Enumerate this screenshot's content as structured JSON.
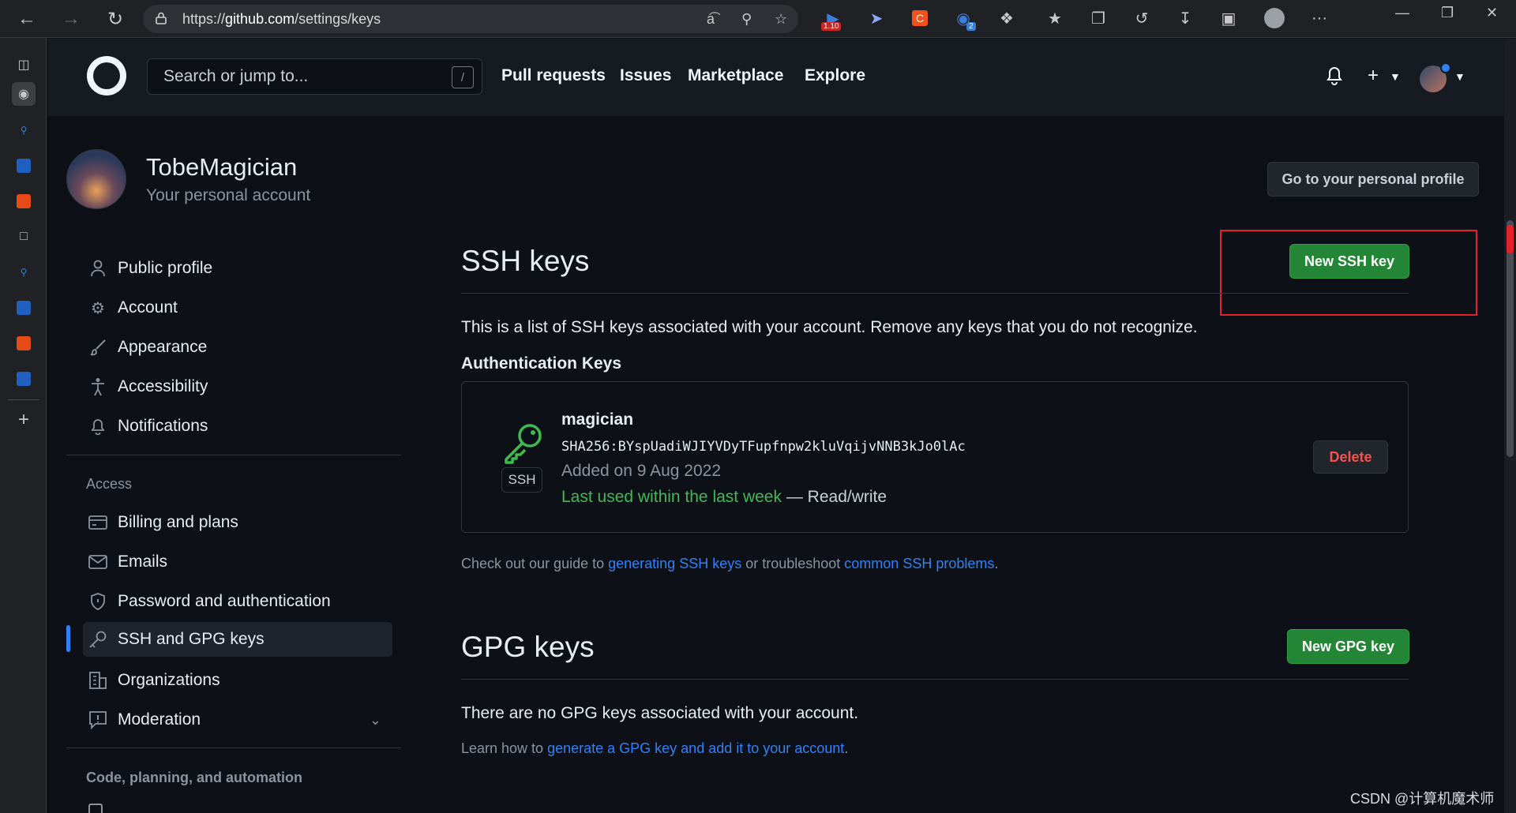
{
  "browser": {
    "url_prefix": "https://",
    "url_domain": "github.com",
    "url_path": "/settings/keys",
    "extension_badge_1": "1.10",
    "extension_badge_2": "2",
    "more": "···"
  },
  "header": {
    "search_placeholder": "Search or jump to...",
    "search_shortcut": "/",
    "nav": [
      "Pull requests",
      "Issues",
      "Marketplace",
      "Explore"
    ]
  },
  "profile": {
    "name": "TobeMagician",
    "subtitle": "Your personal account",
    "button": "Go to your personal profile"
  },
  "menu": {
    "items_top": [
      "Public profile",
      "Account",
      "Appearance",
      "Accessibility",
      "Notifications"
    ],
    "access_heading": "Access",
    "items_access": [
      "Billing and plans",
      "Emails",
      "Password and authentication",
      "SSH and GPG keys",
      "Organizations",
      "Moderation"
    ],
    "code_heading": "Code, planning, and automation"
  },
  "ssh": {
    "title": "SSH keys",
    "new_button": "New SSH key",
    "description": "This is a list of SSH keys associated with your account. Remove any keys that you do not recognize.",
    "auth_heading": "Authentication Keys",
    "key": {
      "name": "magician",
      "badge": "SSH",
      "fingerprint": "SHA256:BYspUadiWJIYVDyTFupfnpw2kluVqijvNNB3kJo0lAc",
      "added": "Added on 9 Aug 2022",
      "last_used": "Last used within the last week",
      "access": " — Read/write",
      "delete_button": "Delete"
    },
    "help_prefix": "Check out our guide to ",
    "help_link1": "generating SSH keys",
    "help_middle": " or troubleshoot ",
    "help_link2": "common SSH problems",
    "help_suffix": "."
  },
  "gpg": {
    "title": "GPG keys",
    "new_button": "New GPG key",
    "description": "There are no GPG keys associated with your account.",
    "help_prefix": "Learn how to ",
    "help_link": "generate a GPG key and add it to your account",
    "help_suffix": "."
  },
  "watermark": "CSDN @计算机魔术师",
  "colors": {
    "background": "#0d1117",
    "header": "#161b22",
    "green_button": "#238636",
    "link": "#2f81f7",
    "danger": "#f85149",
    "highlight_box": "#e5202b"
  }
}
